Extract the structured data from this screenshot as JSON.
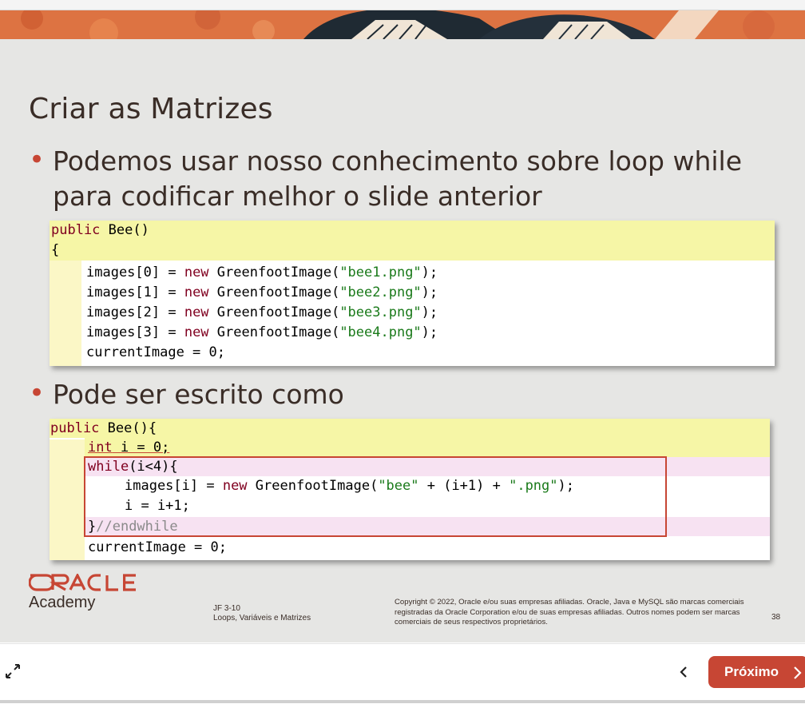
{
  "slide": {
    "title": "Criar as Matrizes",
    "bullet1": "Podemos usar nosso conhecimento sobre loop while para codificar melhor o slide anterior",
    "bullet2": "Pode ser escrito como",
    "bullet_marker": "•"
  },
  "code1": {
    "lines": [
      "public Bee()",
      "{",
      "    images[0] = new GreenfootImage(\"bee1.png\");",
      "    images[1] = new GreenfootImage(\"bee2.png\");",
      "    images[2] = new GreenfootImage(\"bee3.png\");",
      "    images[3] = new GreenfootImage(\"bee4.png\");",
      "    currentImage = 0;"
    ]
  },
  "code2": {
    "lines": [
      "public Bee(){",
      "    int i = 0;",
      "    while(i<4){",
      "        images[i] = new GreenfootImage(\"bee\" + (i+1) + \".png\");",
      "        i = i+1;",
      "    }//endwhile",
      "    currentImage = 0;"
    ]
  },
  "footer": {
    "logo_text": "ORACLE",
    "academy": "Academy",
    "course_code": "JF 3-10",
    "course_name": "Loops, Variáveis e Matrizes",
    "copyright": "Copyright © 2022, Oracle e/ou suas empresas afiliadas. Oracle, Java e MySQL são marcas comerciais registradas da Oracle Corporation e/ou de suas empresas afiliadas. Outros nomes podem ser marcas comerciais de seus respectivos proprietários.",
    "page_number": "38"
  },
  "toolbar": {
    "expand_icon": "expand-icon",
    "prev_icon": "chevron-left-icon",
    "next_label": "Próximo",
    "next_icon": "chevron-right-icon"
  },
  "colors": {
    "oracle_red": "#c74634",
    "slide_bg": "#e6e6e4",
    "text": "#3a2d27",
    "highlight_yellow": "#f6f6a6",
    "highlight_pink": "#f7e2f2"
  }
}
